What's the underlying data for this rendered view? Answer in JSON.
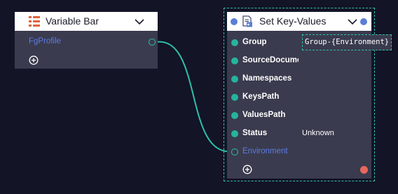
{
  "colors": {
    "canvas_background": "#131426",
    "node_body": "#3a3b4e",
    "node_header": "#ffffff",
    "port_teal": "#26b39f",
    "wire_teal": "#2fbfa8",
    "variable_blue": "#5d7ce6",
    "header_blue_dot": "#5b7fd6",
    "error_dot": "#e8675c",
    "label_white": "#ffffff"
  },
  "variable_bar": {
    "title": "Variable Bar",
    "icon": "list-table-icon",
    "collapse_icon": "chevron-down-icon",
    "items": [
      {
        "label": "FgProfile"
      }
    ],
    "add_icon": "add-circle-icon"
  },
  "set_key_values": {
    "title": "Set Key-Values",
    "icon": "document-key-icon",
    "collapse_icon": "chevron-down-icon",
    "inputs": [
      {
        "label": "Group",
        "value": "Group-{Environment}"
      },
      {
        "label": "SourceDocument",
        "value": ""
      },
      {
        "label": "Namespaces",
        "value": ""
      },
      {
        "label": "KeysPath",
        "value": ""
      },
      {
        "label": "ValuesPath",
        "value": ""
      },
      {
        "label": "Status",
        "value": "Unknown"
      },
      {
        "label": "Environment",
        "value": ""
      }
    ],
    "add_icon": "add-circle-icon",
    "status_indicator": "error-dot"
  }
}
